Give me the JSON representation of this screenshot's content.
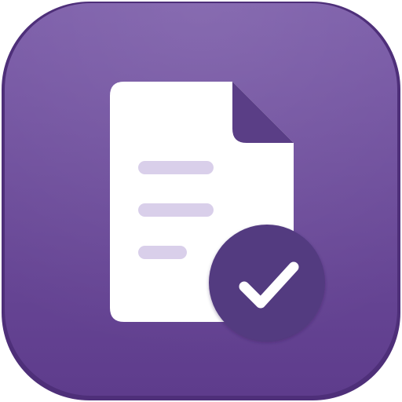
{
  "app_icon": {
    "name": "forms-document-check-icon",
    "label": "",
    "colors": {
      "tile_top": "#7A5BA8",
      "tile_bottom": "#5E3C8C",
      "tile_edge": "#4E2F79",
      "paper": "#FFFFFF",
      "paper_fold": "#5A3E86",
      "text_lines": "#D9CFEA",
      "badge": "#533A80",
      "checkmark": "#FFFFFF"
    },
    "text_line_count": 3,
    "badge_state": "checked"
  }
}
